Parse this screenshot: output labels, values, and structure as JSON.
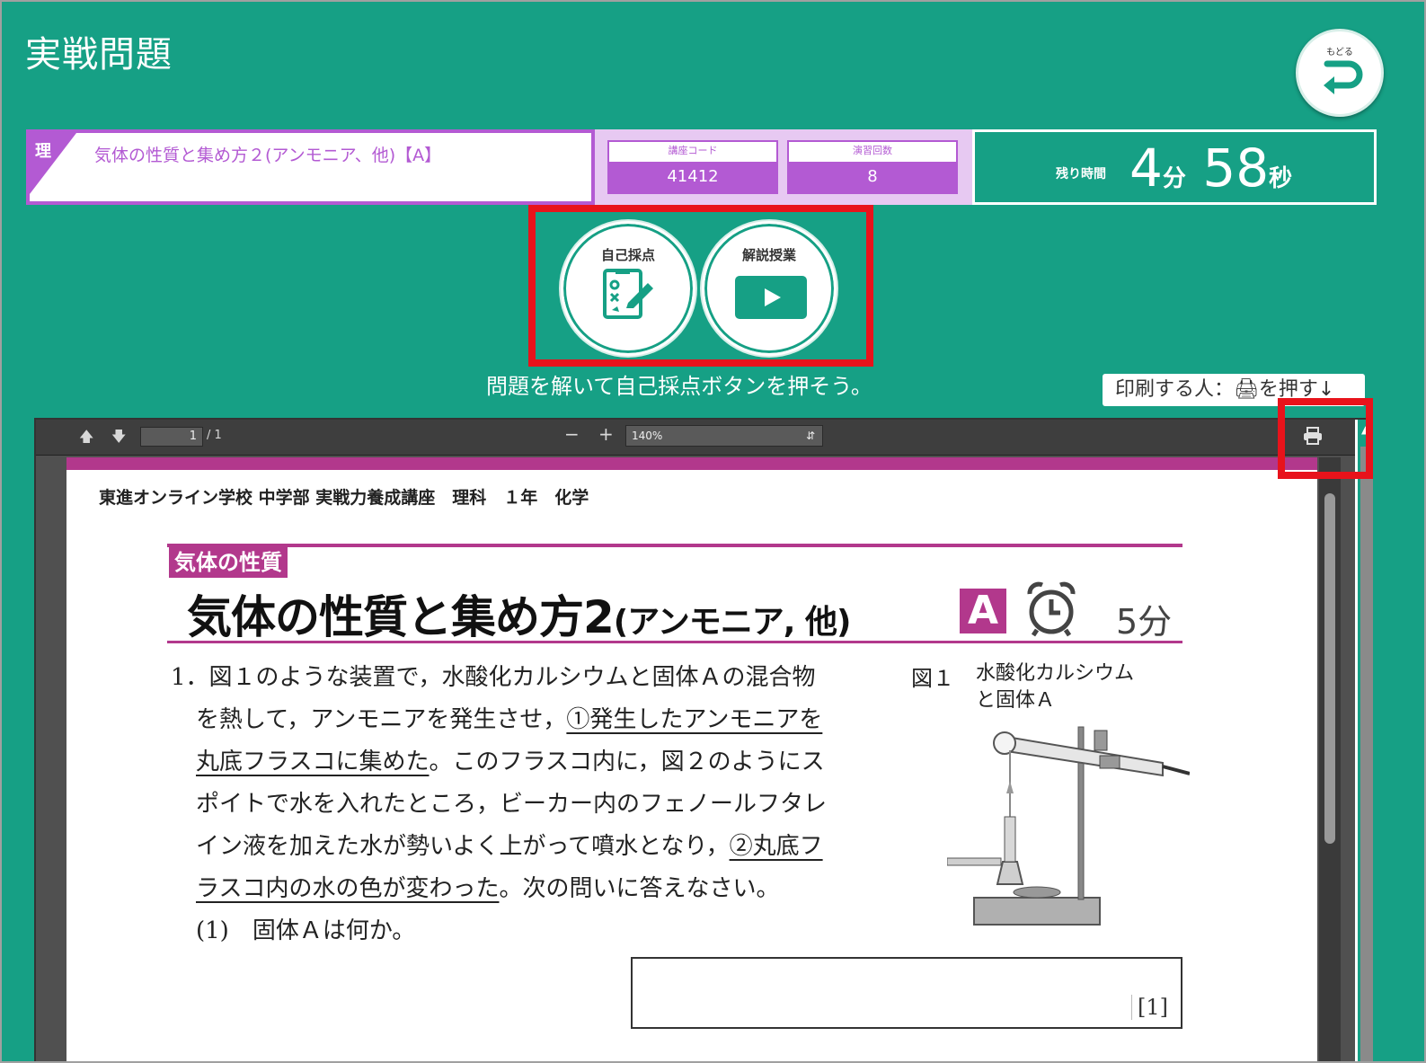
{
  "app": {
    "title": "実戦問題",
    "back_label": "もどる"
  },
  "course": {
    "subject": "理",
    "title": "気体の性質と集め方２(アンモニア、他)【A】",
    "code_label": "講座コード",
    "code_value": "41412",
    "count_label": "演習回数",
    "count_value": "8"
  },
  "timer": {
    "label": "残り時間",
    "minutes": "4",
    "minutes_unit": "分",
    "seconds": "58",
    "seconds_unit": "秒"
  },
  "actions": {
    "self_grade_label": "自己採点",
    "lecture_label": "解説授業",
    "instruction": "問題を解いて自己採点ボタンを押そう。",
    "print_hint": "印刷する人：🖨を押す↓"
  },
  "viewer": {
    "page_current": "1",
    "page_total": "/ 1",
    "zoom": "140%"
  },
  "document": {
    "header": "東進オンライン学校 中学部 実戦力養成講座　理科　１年　化学",
    "category": "気体の性質",
    "title_main": "気体の性質と集め方2",
    "title_sub": "(アンモニア, 他)",
    "level": "A",
    "time": "5分",
    "q1_lines": [
      "1．図１のような装置で，水酸化カルシウムと固体Ａの混合物",
      "を熱して，アンモニアを発生させ，",
      "①発生したアンモニアを",
      "丸底フラスコに集めた",
      "。このフラスコ内に，図２のようにス",
      "ポイトで水を入れたところ，ビーカー内のフェノールフタレ",
      "イン液を加えた水が勢いよく上がって噴水となり，",
      "②丸底フ",
      "ラスコ内の水の色が変わった",
      "。次の問いに答えなさい。"
    ],
    "sub_q1": "(1)　固体Ａは何か。",
    "figure_label": "図１",
    "figure_caption_1": "水酸化カルシウム",
    "figure_caption_2": "と固体Ａ",
    "answer_number": "[1]"
  },
  "colors": {
    "background": "#16a085",
    "purple": "#b35ad3",
    "magenta": "#b2388c",
    "highlight": "#e8131b"
  },
  "icons": {
    "back": "return-arrow-icon",
    "self_grade": "answer-sheet-pencil-icon",
    "lecture": "play-icon",
    "print": "printer-icon",
    "clock": "alarm-clock-icon"
  }
}
